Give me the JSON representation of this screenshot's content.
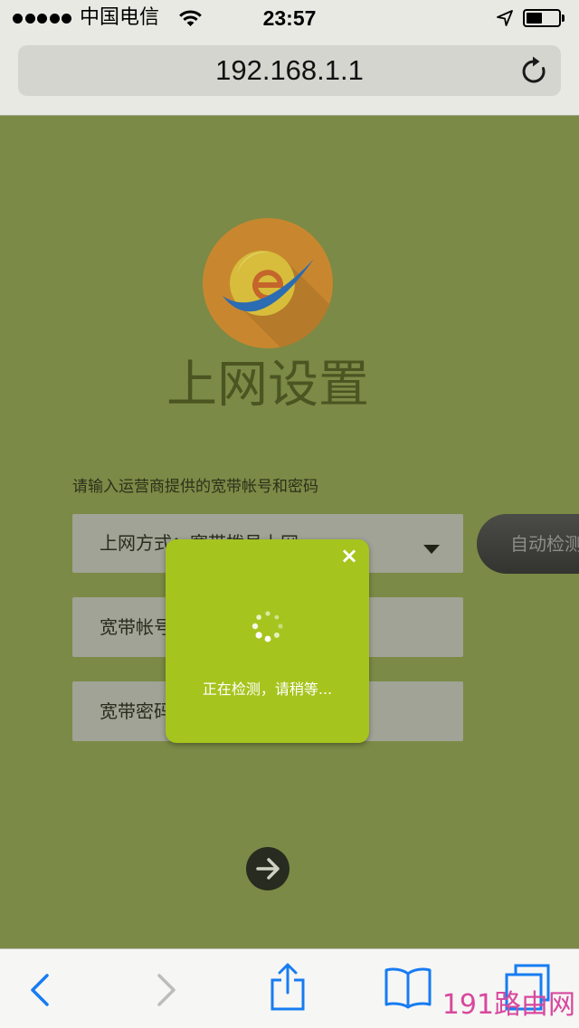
{
  "status_bar": {
    "carrier": "中国电信",
    "time": "23:57",
    "battery_level": 0.5,
    "icons": [
      "signal-strength-icon",
      "wifi-icon",
      "location-arrow-icon",
      "battery-icon"
    ]
  },
  "browser": {
    "url": "192.168.1.1",
    "toolbar_icons": [
      "back-icon",
      "forward-icon",
      "share-icon",
      "bookmarks-icon",
      "tabs-icon"
    ]
  },
  "page": {
    "title": "上网设置",
    "instruction": "请输入运营商提供的宽带帐号和密码",
    "connection_type": "上网方式：宽带拨号上网",
    "auto_detect_label": "自动检测",
    "account_placeholder": "宽带帐号",
    "password_placeholder": "宽带密码",
    "next_icon": "arrow-right-icon"
  },
  "modal": {
    "close_label": "×",
    "message": "正在检测，请稍等...",
    "spinner_icon": "loading-spinner-icon"
  },
  "watermark": {
    "text": "191路由网"
  },
  "colors": {
    "page_background": "#7b8a46",
    "modal_background": "#a6c41e",
    "accent_blue": "#177cf2",
    "watermark": "#d8489e"
  }
}
